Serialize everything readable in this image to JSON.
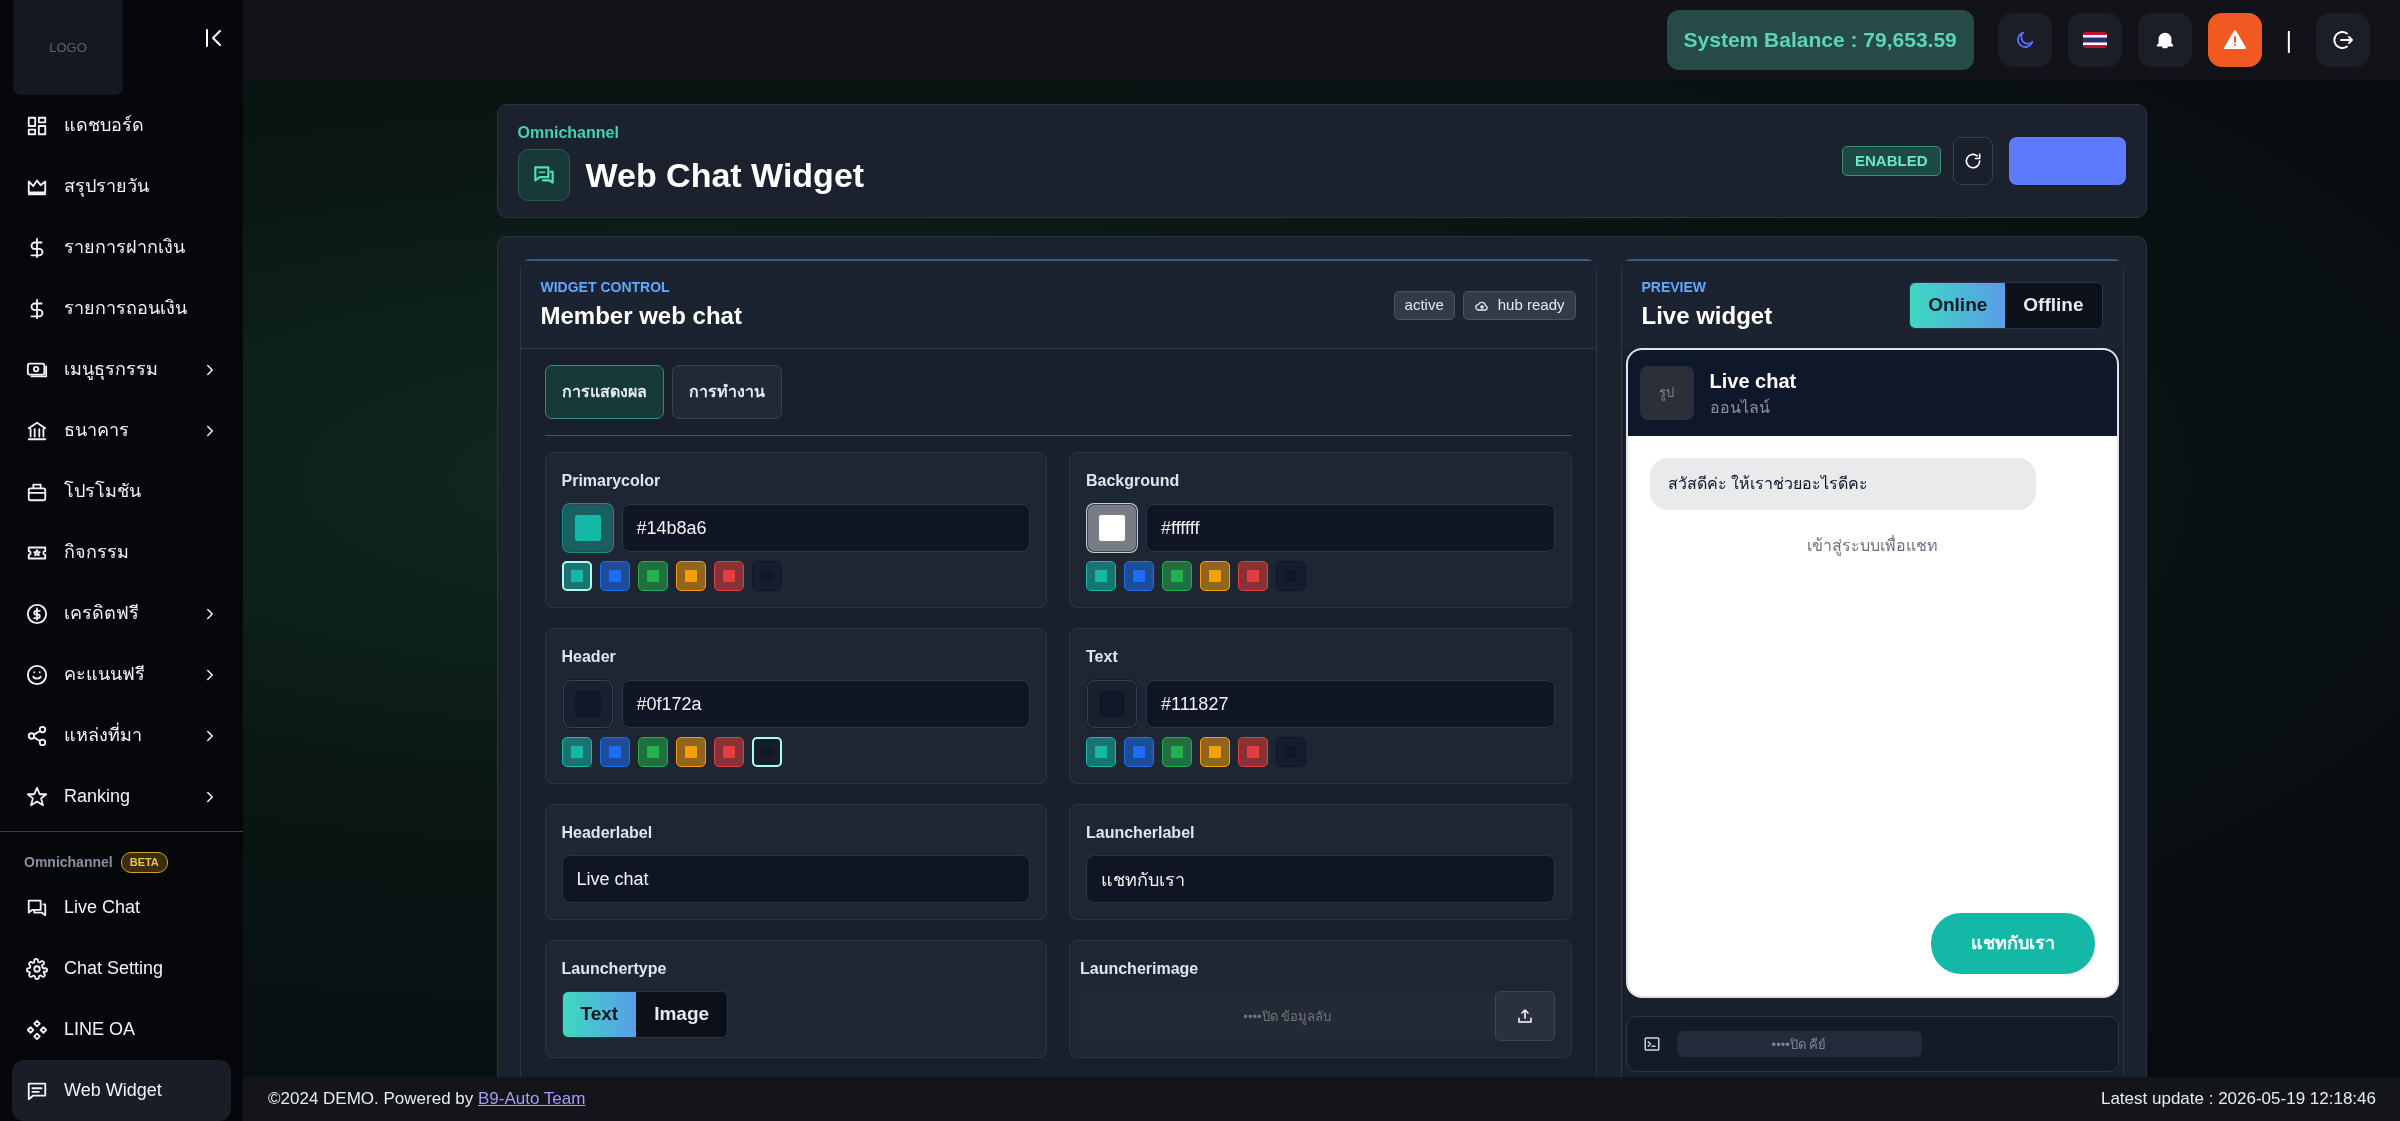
{
  "sidebar": {
    "logo": "LOGO",
    "items": [
      {
        "label": "แดชบอร์ด",
        "has_submenu": false,
        "selected": false
      },
      {
        "label": "สรุปรายวัน",
        "has_submenu": false,
        "selected": false
      },
      {
        "label": "รายการฝากเงิน",
        "has_submenu": false,
        "selected": false
      },
      {
        "label": "รายการถอนเงิน",
        "has_submenu": false,
        "selected": false
      },
      {
        "label": "เมนูธุรกรรม",
        "has_submenu": true,
        "selected": false
      },
      {
        "label": "ธนาคาร",
        "has_submenu": true,
        "selected": false
      },
      {
        "label": "โปรโมชัน",
        "has_submenu": false,
        "selected": false
      },
      {
        "label": "กิจกรรม",
        "has_submenu": false,
        "selected": false
      },
      {
        "label": "เครดิตฟรี",
        "has_submenu": true,
        "selected": false
      },
      {
        "label": "คะแนนฟรี",
        "has_submenu": true,
        "selected": false
      },
      {
        "label": "แหล่งที่มา",
        "has_submenu": true,
        "selected": false
      },
      {
        "label": "Ranking",
        "has_submenu": true,
        "selected": false
      }
    ],
    "section": {
      "title": "Omnichannel",
      "badge": "BETA",
      "items": [
        {
          "label": "Live Chat",
          "selected": false
        },
        {
          "label": "Chat Setting",
          "selected": false
        },
        {
          "label": "LINE OA",
          "selected": false
        },
        {
          "label": "Web Widget",
          "selected": true
        }
      ]
    }
  },
  "topbar": {
    "balance": "System Balance : 79,653.59",
    "separator": "|"
  },
  "page_header": {
    "eyebrow": "Omnichannel",
    "title": "Web Chat Widget",
    "status": "ENABLED"
  },
  "widget_control": {
    "eyebrow": "WIDGET CONTROL",
    "title": "Member web chat",
    "badges": [
      {
        "label": "active",
        "kind": "plain"
      },
      {
        "label": "hub ready",
        "kind": "cloud"
      }
    ],
    "tabs": [
      {
        "label": "การแสดงผล",
        "selected": true
      },
      {
        "label": "การทำงาน",
        "selected": false
      }
    ],
    "fields": [
      {
        "kind": "color",
        "label": "Primarycolor",
        "value": "#14b8a6",
        "color": "#14b8a6",
        "swatches": [
          {
            "color": "#14b8a6",
            "selected": true
          },
          {
            "color": "#1d6ff2",
            "selected": false
          },
          {
            "color": "#22b14c",
            "selected": false
          },
          {
            "color": "#f59e0b",
            "selected": false
          },
          {
            "color": "#e53e3e",
            "selected": false
          },
          {
            "color": "#0f172a",
            "selected": false
          }
        ]
      },
      {
        "kind": "color",
        "label": "Background",
        "value": "#ffffff",
        "color": "#ffffff",
        "swatches": [
          {
            "color": "#14b8a6",
            "selected": false
          },
          {
            "color": "#1d6ff2",
            "selected": false
          },
          {
            "color": "#22b14c",
            "selected": false
          },
          {
            "color": "#f59e0b",
            "selected": false
          },
          {
            "color": "#e53e3e",
            "selected": false
          },
          {
            "color": "#0f172a",
            "selected": false
          }
        ]
      },
      {
        "kind": "color",
        "label": "Header",
        "value": "#0f172a",
        "color": "#0f172a",
        "swatches": [
          {
            "color": "#14b8a6",
            "selected": false
          },
          {
            "color": "#1d6ff2",
            "selected": false
          },
          {
            "color": "#22b14c",
            "selected": false
          },
          {
            "color": "#f59e0b",
            "selected": false
          },
          {
            "color": "#e53e3e",
            "selected": false
          },
          {
            "color": "#0f172a",
            "selected": true
          }
        ]
      },
      {
        "kind": "color",
        "label": "Text",
        "value": "#111827",
        "color": "#111827",
        "swatches": [
          {
            "color": "#14b8a6",
            "selected": false
          },
          {
            "color": "#1d6ff2",
            "selected": false
          },
          {
            "color": "#22b14c",
            "selected": false
          },
          {
            "color": "#f59e0b",
            "selected": false
          },
          {
            "color": "#e53e3e",
            "selected": false
          },
          {
            "color": "#0f172a",
            "selected": false
          }
        ]
      },
      {
        "kind": "text",
        "label": "Headerlabel",
        "value": "Live chat"
      },
      {
        "kind": "text",
        "label": "Launcherlabel",
        "value": "แชทกับเรา"
      },
      {
        "kind": "segmented",
        "label": "Launchertype",
        "options": [
          {
            "label": "Text",
            "selected": true
          },
          {
            "label": "Image",
            "selected": false
          }
        ]
      },
      {
        "kind": "upload",
        "label": "Launcherimage",
        "placeholder": "••••ปิด ข้อมูลลับ"
      }
    ]
  },
  "preview": {
    "eyebrow": "PREVIEW",
    "title": "Live widget",
    "modes": [
      {
        "label": "Online",
        "selected": true
      },
      {
        "label": "Offline",
        "selected": false
      }
    ],
    "chat": {
      "avatar": "รูป",
      "name": "Live chat",
      "status": "ออนไลน์",
      "message": "สวัสดีค่ะ ให้เราช่วยอะไรดีคะ",
      "login_hint": "เข้าสู่ระบบเพื่อแชท",
      "launcher": "แชทกับเรา"
    },
    "key_field": {
      "placeholder": "••••ปิด คีย์"
    }
  },
  "footer": {
    "copyright": "©2024 DEMO. Powered by",
    "link": "B9-Auto Team",
    "latest_update": "Latest update : 2026-05-19 12:18:46"
  }
}
